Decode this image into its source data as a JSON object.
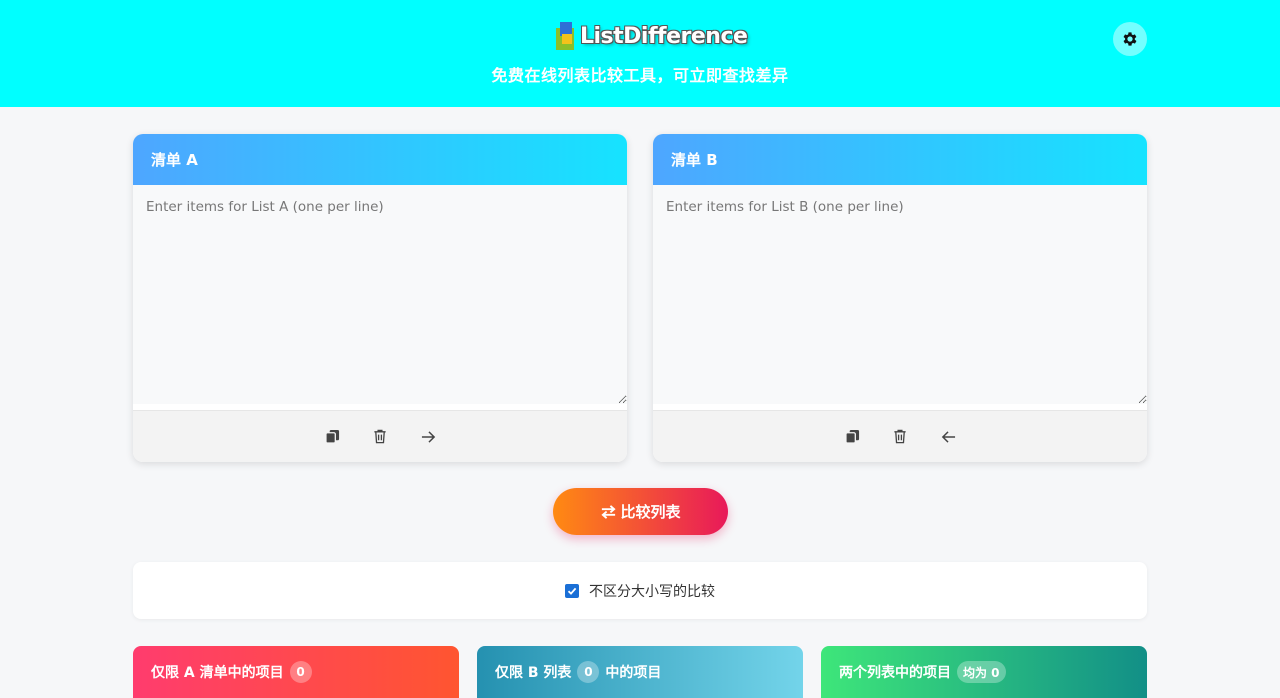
{
  "header": {
    "logo_text": "ListDifference",
    "tagline": "免费在线列表比较工具，可立即查找差异",
    "theme_icon": "gear-icon",
    "background": "#00ffff"
  },
  "list_a": {
    "title": "清单 A",
    "placeholder": "Enter items for List A (one per line)",
    "value": "",
    "tools": [
      "copy-icon",
      "trash-icon",
      "arrow-right-icon"
    ]
  },
  "list_b": {
    "title": "清单 B",
    "placeholder": "Enter items for List B (one per line)",
    "value": "",
    "tools": [
      "copy-icon",
      "trash-icon",
      "arrow-left-icon"
    ]
  },
  "compare_button": {
    "label": "比较列表",
    "icon": "swap-icon"
  },
  "options": {
    "case_insensitive_label": "不区分大小写的比较",
    "case_insensitive_checked": true
  },
  "results": {
    "only_a": {
      "label": "仅限 A 清单中的项目",
      "count": "0",
      "color": "#ff3c6e"
    },
    "only_b": {
      "label_before": "仅限 B 列表",
      "count": "0",
      "label_after": "中的项目",
      "color": "#2591b0"
    },
    "both": {
      "label": "两个列表中的项目",
      "count": "均为 0",
      "color": "#128f87"
    }
  }
}
